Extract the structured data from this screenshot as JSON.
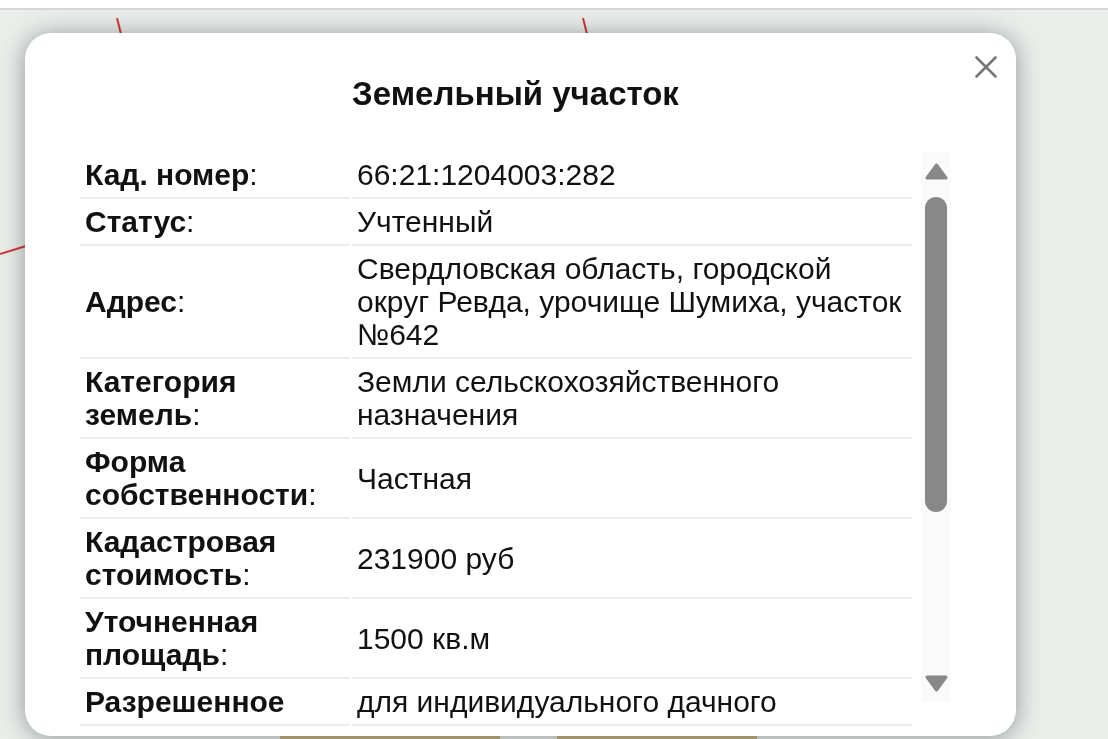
{
  "dialog": {
    "title": "Земельный участок"
  },
  "fields": [
    {
      "label": "**Кад. номер**:",
      "value": "66:21:1204003:282"
    },
    {
      "label": "**Статус**:",
      "value": "Учтенный"
    },
    {
      "label": "**Адрес**:",
      "value": "Свердловская область, городской округ Ревда, урочище Шумиха, участок №642"
    },
    {
      "label": "**Категория земель**:",
      "value": "Земли сельскохозяйственного назначения"
    },
    {
      "label": "**Форма собственности**:",
      "value": "Частная"
    },
    {
      "label": "**Кадастровая стоимость**:",
      "value": "231900 руб"
    },
    {
      "label": "**Уточненная площадь**:",
      "value": "1500 кв.м"
    },
    {
      "label": "**Разрешенное**",
      "value": "для индивидуального дачного"
    }
  ]
}
